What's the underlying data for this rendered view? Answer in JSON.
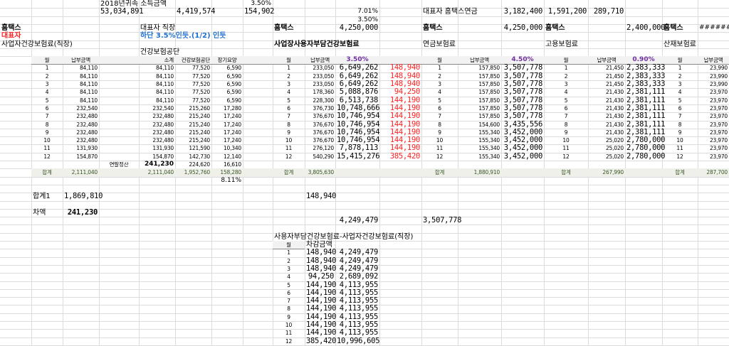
{
  "top": {
    "income_label": "2018년귀속 소득금액",
    "income_total": "53,034,891",
    "income_monthly": "4,419,574",
    "income_calc": "154,902",
    "rate_top": "3.50%",
    "rate_total": "7.01%",
    "rate_half": "3.50%",
    "pension_label": "대표자 홈택스연금",
    "pension_v1": "3,182,400",
    "pension_v2": "1,591,200",
    "pension_v3": "289,710"
  },
  "labels": {
    "hometax": "홈택스",
    "ceo": "대표자",
    "ceo_work": "대표자 직장",
    "note": "하단 3.5%인듯.(1/2) 인듯",
    "biz_health": "사업자건강보험료(직장)",
    "nhis": "건강보험공단",
    "employer_health": "사업장사용자부담건강보험료",
    "pension": "연금보험료",
    "employment": "고용보험료",
    "industrial": "산재보험료",
    "hometax_health_value": "4,250,000",
    "hometax_pension_value": "4,250,000",
    "hometax_employment_value": "2,400,000",
    "hometax_industrial_value": "########"
  },
  "left_table": {
    "headers": {
      "month": "월",
      "pay": "납부금액",
      "subtotal": "소계",
      "nhis": "건강보험공단",
      "ltc": "장기요양"
    },
    "months": [
      "1",
      "2",
      "3",
      "4",
      "5",
      "6",
      "7",
      "8",
      "9",
      "10",
      "11",
      "12"
    ],
    "pay": [
      "84,110",
      "84,110",
      "84,110",
      "84,110",
      "84,110",
      "232,540",
      "232,480",
      "232,480",
      "232,480",
      "232,480",
      "131,930",
      "154,870"
    ],
    "subtotal": [
      "84,110",
      "84,110",
      "84,110",
      "84,110",
      "84,110",
      "232,540",
      "232,480",
      "232,480",
      "232,480",
      "232,480",
      "131,930",
      "154,870"
    ],
    "nhis": [
      "77,520",
      "77,520",
      "77,520",
      "77,520",
      "77,520",
      "215,260",
      "215,240",
      "215,240",
      "215,240",
      "215,240",
      "121,590",
      "142,730"
    ],
    "ltc": [
      "6,590",
      "6,590",
      "6,590",
      "6,590",
      "6,590",
      "17,280",
      "17,240",
      "17,240",
      "17,240",
      "17,240",
      "10,340",
      "12,140"
    ],
    "settlement": {
      "label": "연말정산",
      "subtotal": "241,230",
      "nhis": "224,620",
      "ltc": "16,610"
    },
    "total": {
      "label": "합계",
      "pay": "2,111,040",
      "subtotal": "2,111,040",
      "nhis": "1,952,760",
      "ltc": "158,280"
    },
    "ltc_rate": "8.11%"
  },
  "health_table": {
    "headers": {
      "month": "월",
      "pay": "납부금액",
      "rate": "3.50%"
    },
    "pay": [
      "233,050",
      "233,050",
      "233,050",
      "178,360",
      "228,300",
      "376,730",
      "376,670",
      "376,670",
      "376,670",
      "376,670",
      "276,120",
      "540,290"
    ],
    "base": [
      "6,649,262",
      "6,649,262",
      "6,649,262",
      "5,088,876",
      "6,513,738",
      "10,748,666",
      "10,746,954",
      "10,746,954",
      "10,746,954",
      "10,746,954",
      "7,878,113",
      "15,415,276"
    ],
    "diff": [
      "148,940",
      "148,940",
      "148,940",
      "94,250",
      "144,190",
      "144,190",
      "144,190",
      "144,190",
      "144,190",
      "144,190",
      "144,190",
      "385,420"
    ],
    "total": {
      "label": "합계",
      "pay": "3,805,630"
    }
  },
  "pension_table": {
    "headers": {
      "month": "월",
      "pay": "납부금액",
      "rate": "4.50%"
    },
    "pay": [
      "157,850",
      "157,850",
      "157,850",
      "157,850",
      "157,850",
      "157,850",
      "157,850",
      "154,600",
      "155,340",
      "155,340",
      "155,340",
      "155,340"
    ],
    "base": [
      "3,507,778",
      "3,507,778",
      "3,507,778",
      "3,507,778",
      "3,507,778",
      "3,507,778",
      "3,507,778",
      "3,435,556",
      "3,452,000",
      "3,452,000",
      "3,452,000",
      "3,452,000"
    ],
    "total": {
      "label": "합계",
      "pay": "1,880,910"
    }
  },
  "employment_table": {
    "headers": {
      "month": "월",
      "pay": "납부금액",
      "rate": "0.90%"
    },
    "pay": [
      "21,450",
      "21,450",
      "21,450",
      "21,430",
      "21,430",
      "21,430",
      "21,430",
      "21,430",
      "21,430",
      "25,020",
      "25,020",
      "25,020"
    ],
    "base": [
      "2,383,333",
      "2,383,333",
      "2,383,333",
      "2,381,111",
      "2,381,111",
      "2,381,111",
      "2,381,111",
      "2,381,111",
      "2,381,111",
      "2,780,000",
      "2,780,000",
      "2,780,000"
    ],
    "total": {
      "label": "합계",
      "pay": "267,990"
    }
  },
  "industrial_table": {
    "headers": {
      "month": "월",
      "pay": "납부금액"
    },
    "pay": [
      "23,990",
      "23,990",
      "23,990",
      "23,970",
      "23,970",
      "23,970",
      "23,970",
      "23,970",
      "23,970",
      "23,970",
      "23,970",
      "23,970"
    ],
    "total": {
      "label": "합계",
      "pay": "287,700"
    }
  },
  "summary": {
    "total1_label": "합계1",
    "total1_value": "1,869,810",
    "diff_label": "차액",
    "diff_value": "241,230",
    "health_diff_first": "148,940",
    "health_base_first": "4,249,479",
    "pension_base_first": "3,507,778"
  },
  "diff_table": {
    "title": "사용자부담건강보험료-사업자건강보험료(직장)",
    "headers": {
      "month": "월",
      "diff": "차감금액"
    },
    "diff": [
      "148,940",
      "148,940",
      "148,940",
      "94,250",
      "144,190",
      "144,190",
      "144,190",
      "144,190",
      "144,190",
      "144,190",
      "144,190",
      "385,420"
    ],
    "amount": [
      "4,249,479",
      "4,249,479",
      "4,249,479",
      "2,689,092",
      "4,113,955",
      "4,113,955",
      "4,113,955",
      "4,113,955",
      "4,113,955",
      "4,113,955",
      "4,113,955",
      "10,996,605"
    ]
  },
  "colors": {
    "red": "#ff2020",
    "blue": "#1f6fd0",
    "purple": "#7030a0",
    "green": "#375623"
  }
}
